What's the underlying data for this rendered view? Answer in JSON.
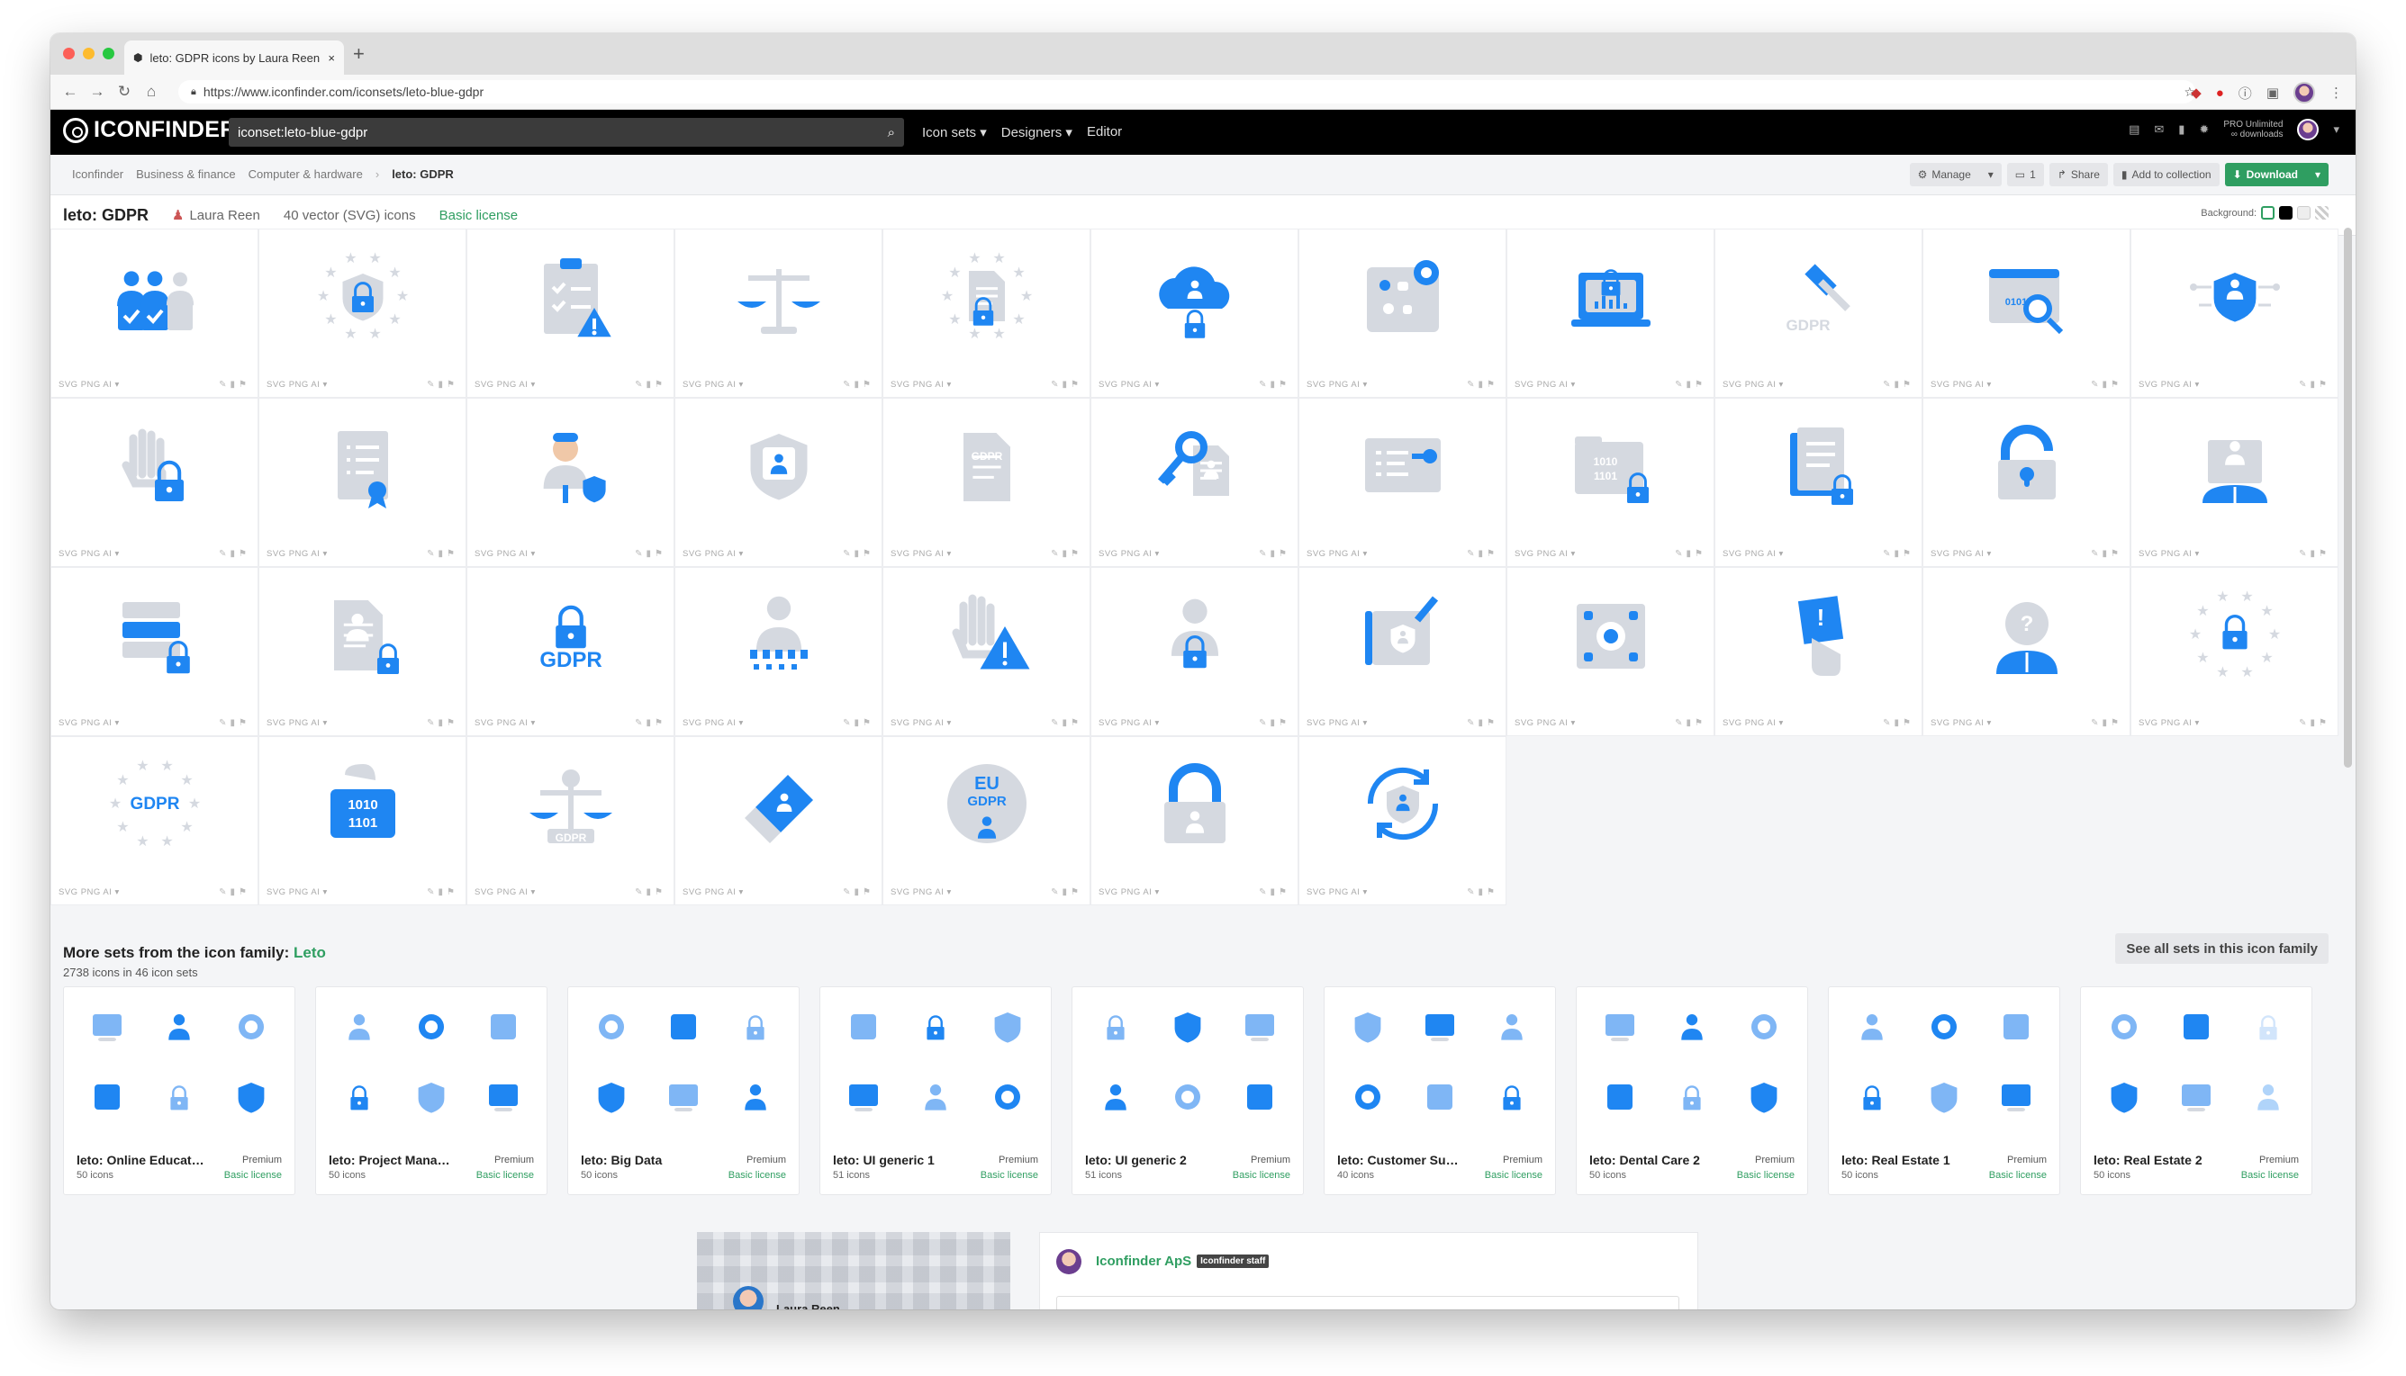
{
  "browser": {
    "tab_title": "leto: GDPR icons by Laura Reen",
    "url": "https://www.iconfinder.com/iconsets/leto-blue-gdpr"
  },
  "site": {
    "logo": "ICONFINDER",
    "search_value": "iconset:leto-blue-gdpr",
    "nav": [
      "Icon sets ▾",
      "Designers ▾",
      "Editor"
    ],
    "pro_line1": "PRO Unlimited",
    "pro_line2": "∞ downloads"
  },
  "breadcrumb": [
    "Iconfinder",
    "Business & finance",
    "Computer & hardware",
    "leto: GDPR"
  ],
  "actions": {
    "manage": "Manage",
    "comments": "1",
    "share": "Share",
    "add": "Add to collection",
    "download": "Download"
  },
  "iconset": {
    "title": "leto: GDPR",
    "author": "Laura Reen",
    "count": "40 vector (SVG) icons",
    "license": "Basic license",
    "background_label": "Background:"
  },
  "cell_meta": "SVG  PNG  AI  ▾",
  "icons": [
    "people-check-icon",
    "eu-stars-lock-icon",
    "clipboard-warning-icon",
    "scales-icon",
    "document-lock-stars-icon",
    "cloud-user-lock-icon",
    "eye-data-grid-icon",
    "laptop-lock-icon",
    "gdpr-gavel-icon",
    "browser-search-data-icon",
    "shield-network-icon",
    "hand-lock-icon",
    "certificate-icon",
    "user-shield-icon",
    "shield-user-icon",
    "gdpr-document-icon",
    "key-user-icon",
    "card-key-icon",
    "folder-binary-lock-icon",
    "documents-lock-icon",
    "padlock-unlocked-icon",
    "businessman-icon",
    "server-lock-icon",
    "document-person-lock-icon",
    "gdpr-lock-icon",
    "user-pixelated-icon",
    "hand-warning-icon",
    "user-lock-icon",
    "shield-pen-icon",
    "eye-shapes-icon",
    "hand-card-alert-icon",
    "question-user-icon",
    "eu-stars-lock-2-icon",
    "gdpr-stars-icon",
    "binary-lock-hand-icon",
    "gdpr-scales-icon",
    "eraser-card-icon",
    "eu-gdpr-user-icon",
    "padlock-user-icon",
    "refresh-user-icon"
  ],
  "family": {
    "title_prefix": "More sets from the icon family:",
    "title_link": "Leto",
    "subtitle": "2738 icons in 46 icon sets",
    "see_all": "See all sets in this icon family",
    "cards": [
      {
        "name": "leto: Online Educat…",
        "count": "50 icons",
        "badge": "Premium",
        "license": "Basic license"
      },
      {
        "name": "leto: Project Mana…",
        "count": "50 icons",
        "badge": "Premium",
        "license": "Basic license"
      },
      {
        "name": "leto: Big Data",
        "count": "50 icons",
        "badge": "Premium",
        "license": "Basic license"
      },
      {
        "name": "leto: UI generic 1",
        "count": "51 icons",
        "badge": "Premium",
        "license": "Basic license"
      },
      {
        "name": "leto: UI generic 2",
        "count": "51 icons",
        "badge": "Premium",
        "license": "Basic license"
      },
      {
        "name": "leto: Customer Su…",
        "count": "40 icons",
        "badge": "Premium",
        "license": "Basic license"
      },
      {
        "name": "leto: Dental Care 2",
        "count": "50 icons",
        "badge": "Premium",
        "license": "Basic license"
      },
      {
        "name": "leto: Real Estate 1",
        "count": "50 icons",
        "badge": "Premium",
        "license": "Basic license"
      },
      {
        "name": "leto: Real Estate 2",
        "count": "50 icons",
        "badge": "Premium",
        "license": "Basic license"
      }
    ]
  },
  "comment": {
    "name": "Iconfinder ApS",
    "badge": "Iconfinder staff",
    "author_snippet": "Laura Reen"
  },
  "colors": {
    "accent": "#2f9e61",
    "icon_blue": "#1f86f2",
    "icon_grey": "#d7dbe2"
  }
}
